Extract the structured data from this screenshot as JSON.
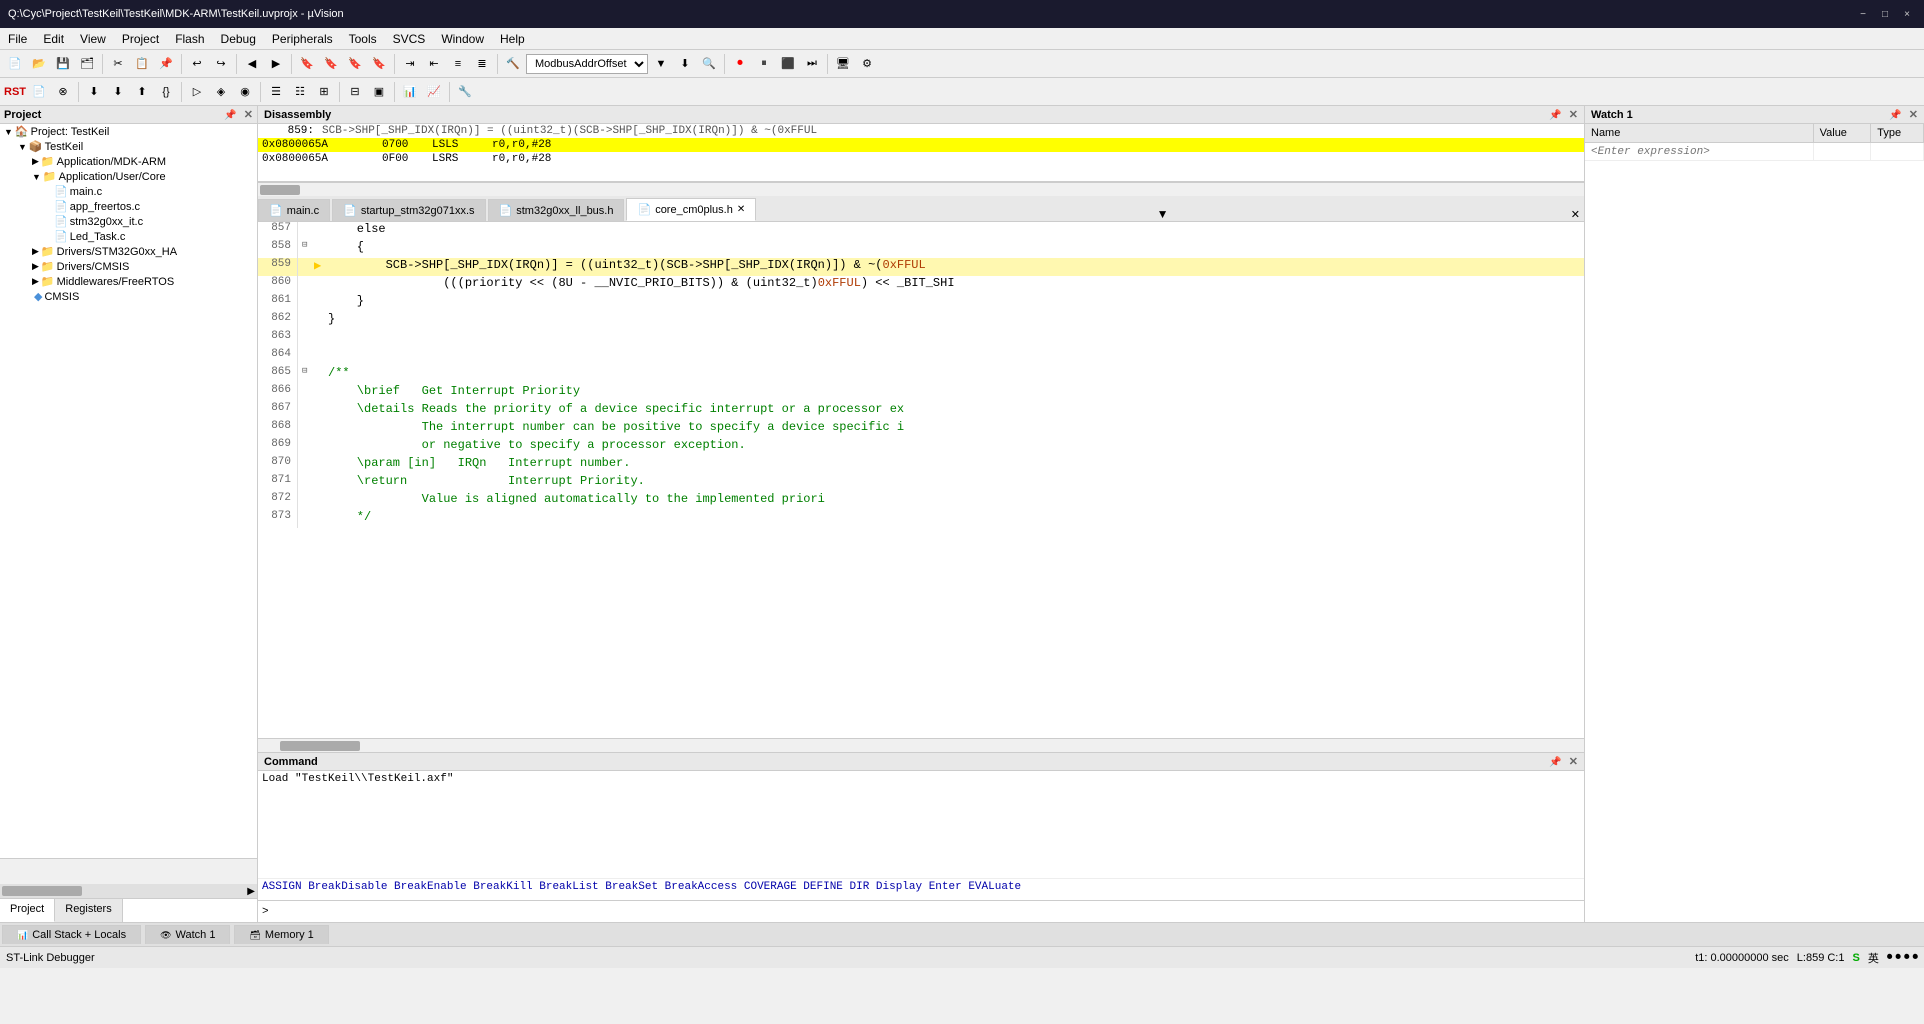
{
  "titlebar": {
    "title": "Q:\\Cyc\\Project\\TestKeil\\TestKeil\\MDK-ARM\\TestKeil.uvprojx - µVision",
    "minimize": "−",
    "maximize": "□",
    "close": "×"
  },
  "menu": {
    "items": [
      "File",
      "Edit",
      "View",
      "Project",
      "Flash",
      "Debug",
      "Peripherals",
      "Tools",
      "SVCS",
      "Window",
      "Help"
    ]
  },
  "toolbar": {
    "combo_label": "ModbusAddrOffset"
  },
  "project": {
    "title": "Project",
    "root": "Project: TestKeil",
    "children": [
      {
        "label": "TestKeil",
        "children": [
          {
            "label": "Application/MDK-ARM",
            "children": []
          },
          {
            "label": "Application/User/Core",
            "children": [
              {
                "label": "main.c"
              },
              {
                "label": "app_freertos.c"
              },
              {
                "label": "stm32g0xx_it.c"
              },
              {
                "label": "Led_Task.c"
              }
            ]
          },
          {
            "label": "Drivers/STM32G0xx_HA",
            "children": []
          },
          {
            "label": "Drivers/CMSIS",
            "children": []
          },
          {
            "label": "Middlewares/FreeRTOS",
            "children": []
          },
          {
            "label": "CMSIS",
            "type": "gem"
          }
        ]
      }
    ],
    "tabs": [
      "Project",
      "Registers"
    ]
  },
  "disassembly": {
    "title": "Disassembly",
    "lines": [
      {
        "prefix": "859:",
        "addr": "",
        "hex": "",
        "mnem": "SCB->SHP[_SHP_IDX(IRQn)] = ((uint32_t)(SCB->SHP[_SHP_IDX(IRQn)]) & ~(0xFFUL",
        "active": false,
        "comment": true
      },
      {
        "prefix": "",
        "addr": "0x0800065A",
        "hex": "0700",
        "mnem": "LSLS",
        "ops": "r0,r0,#28",
        "active": true
      },
      {
        "prefix": "",
        "addr": "0x0800065A",
        "hex": "0F00",
        "mnem": "LSRS",
        "ops": "r0,r0,#28",
        "active": false
      }
    ]
  },
  "editor": {
    "tabs": [
      {
        "label": "main.c",
        "active": false
      },
      {
        "label": "startup_stm32g071xx.s",
        "active": false
      },
      {
        "label": "stm32g0xx_ll_bus.h",
        "active": false
      },
      {
        "label": "core_cm0plus.h",
        "active": true
      }
    ],
    "lines": [
      {
        "num": 857,
        "content": "    else",
        "fold": false,
        "type": "code"
      },
      {
        "num": 858,
        "content": "    {",
        "fold": true,
        "type": "code"
      },
      {
        "num": 859,
        "content": "        SCB->SHP[_SHP_IDX(IRQn)] = ((uint32_t)(SCB->SHP[_SHP_IDX(IRQn)]) & ~(0xFFUL",
        "fold": false,
        "type": "code",
        "active": true,
        "arrow": true
      },
      {
        "num": 860,
        "content": "                (((priority << (8U - __NVIC_PRIO_BITS)) & (uint32_t)0xFFUL) << _BIT_SHI",
        "fold": false,
        "type": "code"
      },
      {
        "num": 861,
        "content": "    }",
        "fold": false,
        "type": "code"
      },
      {
        "num": 862,
        "content": "}",
        "fold": false,
        "type": "code"
      },
      {
        "num": 863,
        "content": "",
        "fold": false,
        "type": "code"
      },
      {
        "num": 864,
        "content": "",
        "fold": false,
        "type": "code"
      },
      {
        "num": 865,
        "content": "/**",
        "fold": true,
        "type": "comment"
      },
      {
        "num": 866,
        "content": "    \\brief   Get Interrupt Priority",
        "fold": false,
        "type": "comment"
      },
      {
        "num": 867,
        "content": "    \\details Reads the priority of a device specific interrupt or a processor ex",
        "fold": false,
        "type": "comment"
      },
      {
        "num": 868,
        "content": "             The interrupt number can be positive to specify a device specific i",
        "fold": false,
        "type": "comment"
      },
      {
        "num": 869,
        "content": "             or negative to specify a processor exception.",
        "fold": false,
        "type": "comment"
      },
      {
        "num": 870,
        "content": "    \\param [in]   IRQn   Interrupt number.",
        "fold": false,
        "type": "comment"
      },
      {
        "num": 871,
        "content": "    \\return              Interrupt Priority.",
        "fold": false,
        "type": "comment"
      },
      {
        "num": 872,
        "content": "             Value is aligned automatically to the implemented priori",
        "fold": false,
        "type": "comment"
      },
      {
        "num": 873,
        "content": "    */",
        "fold": false,
        "type": "comment"
      }
    ]
  },
  "watch": {
    "title": "Watch 1",
    "columns": [
      "Name",
      "Value",
      "Type"
    ],
    "expr_placeholder": "<Enter expression>"
  },
  "command": {
    "title": "Command",
    "output": "Load \"TestKeil\\\\TestKeil.axf\"",
    "hints": "ASSIGN BreakDisable BreakEnable BreakKill BreakList BreakSet BreakAccess COVERAGE DEFINE DIR Display Enter EVALuate",
    "prompt": ">"
  },
  "bottom_tabs": [
    {
      "label": "Call Stack + Locals",
      "active": false
    },
    {
      "label": "Watch 1",
      "active": false
    },
    {
      "label": "Memory 1",
      "active": false
    }
  ],
  "status": {
    "left": "ST-Link Debugger",
    "time": "t1: 0.00000000 sec",
    "position": "L:859 C:1"
  }
}
